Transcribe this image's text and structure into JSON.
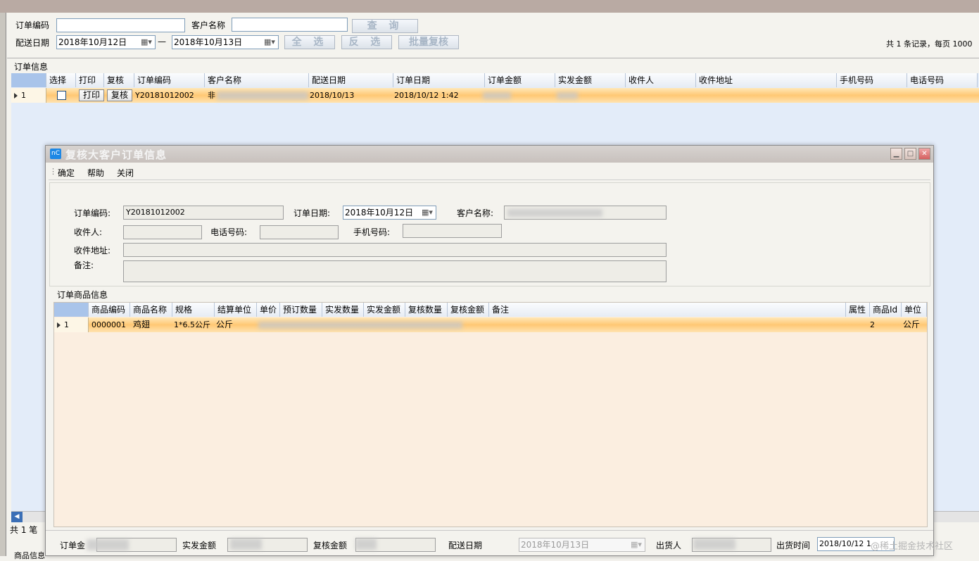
{
  "filters": {
    "order_no_label": "订单编码",
    "customer_label": "客户名称",
    "date_label": "配送日期",
    "date_from": "2018年10月12日",
    "dash": "—",
    "date_to": "2018年10月13日",
    "query_btn": "查 询",
    "select_all_btn": "全 选",
    "invert_btn": "反 选",
    "batch_review_btn": "批量复核",
    "record_info": "共 1 条记录，每页 1000"
  },
  "order_section_title": "订单信息",
  "order_table": {
    "headers": [
      "选择",
      "打印",
      "复核",
      "订单编码",
      "客户名称",
      "配送日期",
      "订单日期",
      "订单金额",
      "实发金额",
      "收件人",
      "收件地址",
      "手机号码",
      "电话号码"
    ],
    "rows": [
      {
        "index": "1",
        "print": "打印",
        "review": "复核",
        "order_no": "Y20181012002",
        "customer": "非",
        "delivery_date": "2018/10/13",
        "order_date": "2018/10/12 1:42"
      }
    ]
  },
  "footer_count": "共 1 笔",
  "product_info_cut": "商品信息",
  "dialog": {
    "title": "复核大客户订单信息",
    "icon_text": "nC",
    "menu": [
      "确定",
      "帮助",
      "关闭"
    ],
    "order_no_label": "订单编码:",
    "order_no": "Y20181012002",
    "order_date_label": "订单日期:",
    "order_date": "2018年10月12日",
    "customer_label": "客户名称:",
    "receiver_label": "收件人:",
    "phone_label": "电话号码:",
    "mobile_label": "手机号码:",
    "address_label": "收件地址:",
    "remark_label": "备注:",
    "goods_section_title": "订单商品信息",
    "goods_headers": [
      "商品编码",
      "商品名称",
      "规格",
      "结算单位",
      "单价",
      "预订数量",
      "实发数量",
      "实发金额",
      "复核数量",
      "复核金额",
      "备注",
      "属性",
      "商品Id",
      "单位"
    ],
    "goods_rows": [
      {
        "index": "1",
        "code": "0000001",
        "name": "鸡翅",
        "spec": "1*6.5公斤",
        "unit": "公斤",
        "goods_id": "2",
        "unit2": "公斤"
      }
    ],
    "bottom": {
      "order_amount_label": "订单金",
      "actual_amount_label": "实发金额",
      "review_amount_label": "复核金额",
      "delivery_date_label": "配送日期",
      "delivery_date": "2018年10月13日",
      "shipper_label": "出货人",
      "ship_time_label": "出货时间",
      "ship_time": "2018/10/12 1",
      "watermark": "@稀土掘金技术社区"
    }
  }
}
